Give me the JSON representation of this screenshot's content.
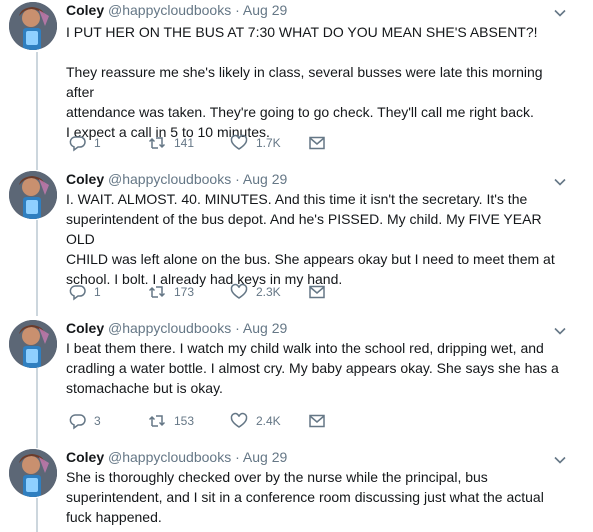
{
  "tweets": [
    {
      "name": "Coley",
      "handle": "@happycloudbooks",
      "separator": "·",
      "date": "Aug 29",
      "text": "I PUT HER ON THE BUS AT 7:30 WHAT DO YOU MEAN SHE'S ABSENT?!\n\nThey reassure me she's likely in class, several busses were late this morning after\nattendance was taken. They're going to go check. They'll call me right back.\nI expect a call in 5 to 10 minutes.",
      "replies": "1",
      "retweets": "141",
      "likes": "1.7K"
    },
    {
      "name": "Coley",
      "handle": "@happycloudbooks",
      "separator": "·",
      "date": "Aug 29",
      "text": "I. WAIT. ALMOST. 40. MINUTES. And this time it isn't the secretary. It's the\nsuperintendent of the bus depot. And he's PISSED. My child. My FIVE YEAR OLD\nCHILD was left alone on the bus. She appears okay but I need to meet them at\nschool. I bolt. I already had keys in my hand.",
      "replies": "1",
      "retweets": "173",
      "likes": "2.3K"
    },
    {
      "name": "Coley",
      "handle": "@happycloudbooks",
      "separator": "·",
      "date": "Aug 29",
      "text": "I beat them there. I watch my child walk into the school red, dripping wet, and\ncradling a water bottle. I almost cry. My baby appears okay. She says she has a\nstomachache but is okay.",
      "replies": "3",
      "retweets": "153",
      "likes": "2.4K"
    },
    {
      "name": "Coley",
      "handle": "@happycloudbooks",
      "separator": "·",
      "date": "Aug 29",
      "text": "She is thoroughly checked over by the nurse while the principal, bus\nsuperintendent, and I sit in a conference room discussing just what the actual\nfuck happened."
    }
  ],
  "icons": {
    "reply": "reply-icon",
    "retweet": "retweet-icon",
    "like": "heart-icon",
    "dm": "envelope-icon",
    "caret": "chevron-down-icon"
  },
  "colors": {
    "text": "#14171a",
    "muted": "#657786",
    "thread_line": "#ccd6dd"
  }
}
